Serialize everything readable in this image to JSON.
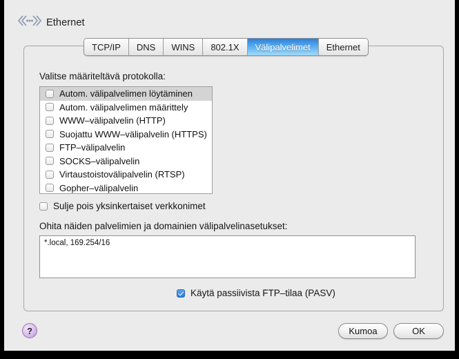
{
  "window": {
    "title": "Ethernet",
    "icon": "ethernet-icon"
  },
  "tabs": [
    {
      "label": "TCP/IP",
      "selected": false
    },
    {
      "label": "DNS",
      "selected": false
    },
    {
      "label": "WINS",
      "selected": false
    },
    {
      "label": "802.1X",
      "selected": false
    },
    {
      "label": "Välipalvelimet",
      "selected": true
    },
    {
      "label": "Ethernet",
      "selected": false
    }
  ],
  "panel": {
    "protocol_label": "Valitse määriteltävä protokolla:",
    "protocols": [
      {
        "label": "Autom. välipalvelimen löytäminen",
        "checked": false,
        "selected": true
      },
      {
        "label": "Autom. välipalvelimen määrittely",
        "checked": false,
        "selected": false
      },
      {
        "label": "WWW–välipalvelin (HTTP)",
        "checked": false,
        "selected": false
      },
      {
        "label": "Suojattu WWW–välipalvelin (HTTPS)",
        "checked": false,
        "selected": false
      },
      {
        "label": "FTP–välipalvelin",
        "checked": false,
        "selected": false
      },
      {
        "label": "SOCKS–välipalvelin",
        "checked": false,
        "selected": false
      },
      {
        "label": "Virtaustoistovälipalvelin (RTSP)",
        "checked": false,
        "selected": false
      },
      {
        "label": "Gopher–välipalvelin",
        "checked": false,
        "selected": false
      }
    ],
    "simple_names": {
      "label": "Sulje pois yksinkertaiset verkkonimet",
      "checked": false
    },
    "bypass_label": "Ohita näiden palvelimien ja domainien välipalvelinasetukset:",
    "bypass_value": "*.local, 169.254/16",
    "pasv": {
      "label": "Käytä passiivista FTP–tilaa (PASV)",
      "checked": true
    }
  },
  "footer": {
    "help_label": "?",
    "cancel_label": "Kumoa",
    "ok_label": "OK"
  },
  "colors": {
    "selected_tab_blue": "#52a8ee",
    "checkbox_blue": "#2c77cf",
    "help_purple": "#b48fd0",
    "sheet_background": "#ebebeb",
    "row_selected_gray": "#d4d4d4"
  }
}
